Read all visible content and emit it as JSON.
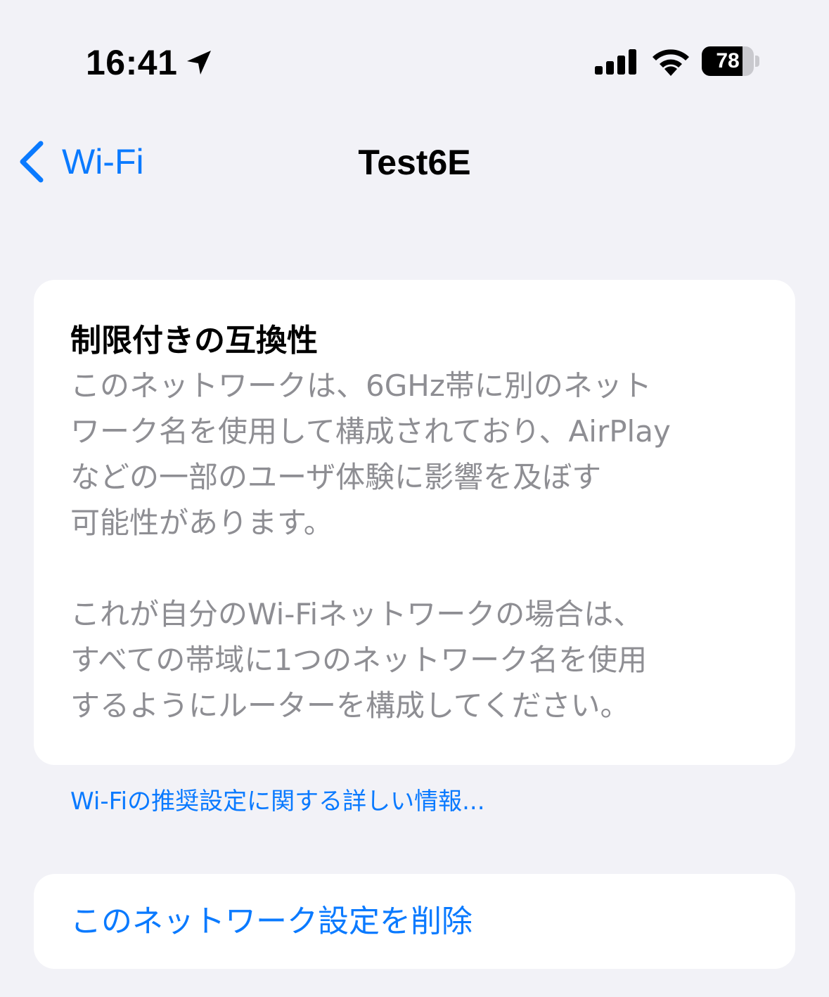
{
  "status_bar": {
    "time": "16:41",
    "battery_level": "78",
    "battery_fraction": 0.78,
    "location_icon": "location-arrow-icon",
    "signal_icon": "cellular-signal-icon",
    "wifi_icon": "wifi-icon"
  },
  "nav": {
    "back_label": "Wi-Fi",
    "title": "Test6E"
  },
  "info_card": {
    "title": "制限付きの互換性",
    "paragraph_1_lines": [
      "このネットワークは、6GHz帯に別のネット",
      "ワーク名を使用して構成されており、AirPlay",
      "などの一部のユーザ体験に影響を及ぼす",
      "可能性があります。"
    ],
    "paragraph_2_lines": [
      "これが自分のWi-Fiネットワークの場合は、",
      "すべての帯域に1つのネットワーク名を使用",
      "するようにルーターを構成してください。"
    ]
  },
  "learn_more_link": "Wi-Fiの推奨設定に関する詳しい情報...",
  "forget_button": "このネットワーク設定を削除",
  "colors": {
    "background": "#f2f2f7",
    "card": "#ffffff",
    "accent": "#0a7aff",
    "secondary_text": "#8e8e93"
  }
}
